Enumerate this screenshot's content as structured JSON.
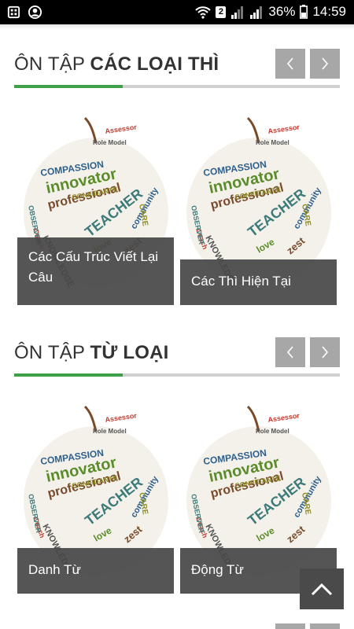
{
  "status_bar": {
    "left_icons": [
      "gallery-icon",
      "account-circle-icon"
    ],
    "sim_label": "2",
    "battery_percent": "36%",
    "time": "14:59"
  },
  "sections": [
    {
      "title_light": "ÔN TẬP ",
      "title_bold": "CÁC LOẠI THÌ",
      "prev_icon": "chevron-left-icon",
      "next_icon": "chevron-right-icon",
      "cards": [
        {
          "caption": "Các Cấu Trúc Viết Lại Câu"
        },
        {
          "caption": "Các Thì Hiện Tại"
        }
      ]
    },
    {
      "title_light": "ÔN TẬP ",
      "title_bold": "TỪ LOẠI",
      "prev_icon": "chevron-left-icon",
      "next_icon": "chevron-right-icon",
      "cards": [
        {
          "caption": "Danh Từ"
        },
        {
          "caption": "Động Từ"
        }
      ]
    }
  ],
  "card_art_words": [
    "Assessor",
    "COMPASSION",
    "innovator",
    "professional",
    "CONFIDANTE",
    "TEACHER",
    "KNOWLEDGE",
    "Coach",
    "community",
    "love",
    "zest",
    "CARE",
    "OBSERVER",
    "Role Model"
  ],
  "scroll_top_icon": "chevron-up-icon",
  "colors": {
    "accent": "#3ea14a",
    "nav_button": "#a7a7a7",
    "caption_bg": "#464646"
  }
}
